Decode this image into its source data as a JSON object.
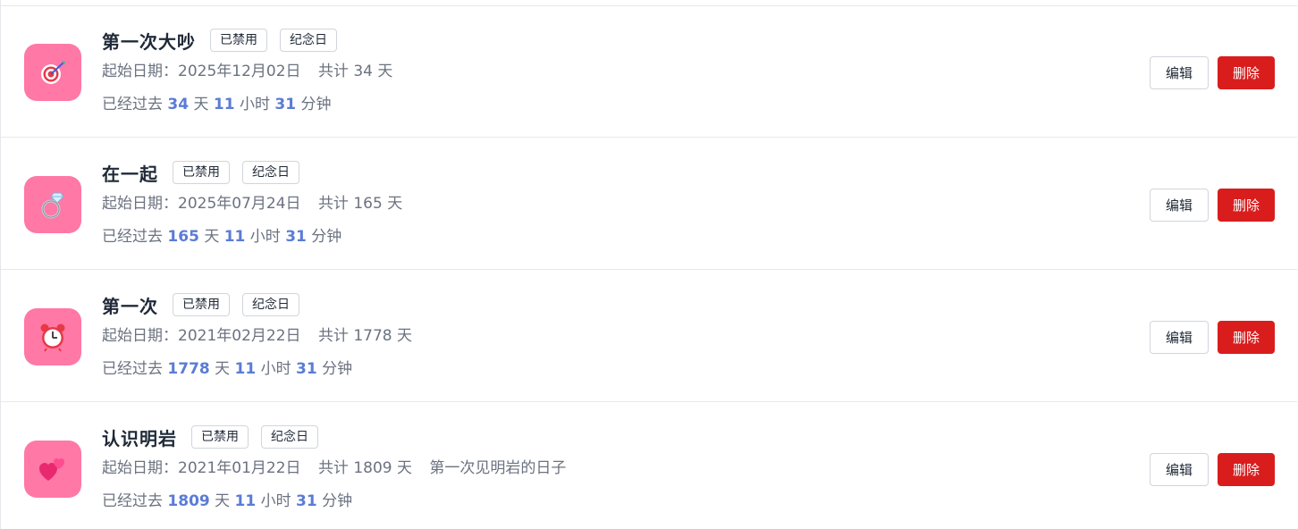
{
  "items": [
    {
      "icon": "target-icon",
      "title": "第一次大吵",
      "tags": [
        "已禁用",
        "纪念日"
      ],
      "start_date": "起始日期：2025年12月02日",
      "total": "共计 34 天",
      "note": "",
      "elapsed_prefix": "已经过去",
      "days": "34",
      "days_unit": "天",
      "hours": "11",
      "hours_unit": "小时",
      "minutes": "31",
      "minutes_unit": "分钟",
      "edit_label": "编辑",
      "delete_label": "删除"
    },
    {
      "icon": "ring-icon",
      "title": "在一起",
      "tags": [
        "已禁用",
        "纪念日"
      ],
      "start_date": "起始日期：2025年07月24日",
      "total": "共计 165 天",
      "note": "",
      "elapsed_prefix": "已经过去",
      "days": "165",
      "days_unit": "天",
      "hours": "11",
      "hours_unit": "小时",
      "minutes": "31",
      "minutes_unit": "分钟",
      "edit_label": "编辑",
      "delete_label": "删除"
    },
    {
      "icon": "alarm-clock-icon",
      "title": "第一次",
      "tags": [
        "已禁用",
        "纪念日"
      ],
      "start_date": "起始日期：2021年02月22日",
      "total": "共计 1778 天",
      "note": "",
      "elapsed_prefix": "已经过去",
      "days": "1778",
      "days_unit": "天",
      "hours": "11",
      "hours_unit": "小时",
      "minutes": "31",
      "minutes_unit": "分钟",
      "edit_label": "编辑",
      "delete_label": "删除"
    },
    {
      "icon": "two-hearts-icon",
      "title": "认识明岩",
      "tags": [
        "已禁用",
        "纪念日"
      ],
      "start_date": "起始日期：2021年01月22日",
      "total": "共计 1809 天",
      "note": "第一次见明岩的日子",
      "elapsed_prefix": "已经过去",
      "days": "1809",
      "days_unit": "天",
      "hours": "11",
      "hours_unit": "小时",
      "minutes": "31",
      "minutes_unit": "分钟",
      "edit_label": "编辑",
      "delete_label": "删除"
    }
  ],
  "colors": {
    "icon_bg": "#ff78a6",
    "number": "#5b7cd6",
    "delete_bg": "#d91d1d"
  }
}
